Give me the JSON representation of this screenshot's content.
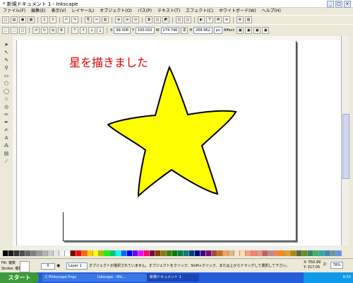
{
  "window": {
    "title": "* 新規ドキュメント 1 - Inkscape",
    "controls": [
      "_",
      "□",
      "×"
    ]
  },
  "menu": [
    "ファイル(F)",
    "編集(E)",
    "表示(V)",
    "レイヤー(L)",
    "オブジェクト(O)",
    "パス(P)",
    "テキスト(T)",
    "エフェクト(C)",
    "ホワイトボード(W)",
    "ヘルプ(H)"
  ],
  "toolbar2": {
    "x_label": "X",
    "x_value": "99.308",
    "y_label": "Y",
    "y_value": "100.002",
    "w_label": "W",
    "w_value": "274.746",
    "h_label": "H",
    "h_value": "268.962",
    "unit": "px",
    "affect_label": "Affect:"
  },
  "canvas": {
    "text": "星を描きました",
    "text_color": "#d90000",
    "star_fill": "#ffff00",
    "star_stroke": "#000000"
  },
  "palette_colors": [
    "#000000",
    "#1a1a1a",
    "#333333",
    "#4d4d4d",
    "#666666",
    "#808080",
    "#999999",
    "#b3b3b3",
    "#cccccc",
    "#e6e6e6",
    "#f2f2f2",
    "#ffffff",
    "#800000",
    "#ff0000",
    "#ff6600",
    "#ffcc00",
    "#ffff00",
    "#99cc00",
    "#00ff00",
    "#00cc66",
    "#00ffff",
    "#0066ff",
    "#0000ff",
    "#6600ff",
    "#ff00ff",
    "#ff0066",
    "#800040",
    "#804000",
    "#808000",
    "#408000",
    "#008000",
    "#008040",
    "#008080",
    "#004080",
    "#000080",
    "#400080",
    "#800080",
    "#a0522d",
    "#d2691e",
    "#f4a460",
    "#deb887",
    "#ffe4c4",
    "#ffdead",
    "#ffa07a",
    "#fa8072",
    "#e9967a",
    "#cd5c5c",
    "#bc8f8f",
    "#ff7f50",
    "#ff8c00",
    "#daa520",
    "#b8860b",
    "#556b2f",
    "#6b8e23",
    "#2e8b57",
    "#3cb371",
    "#20b2aa",
    "#4682b4",
    "#5f9ea0",
    "#6495ed"
  ],
  "status": {
    "fill_label": "Fill:",
    "fill_value": "複数",
    "stroke_label": "Stroke:",
    "stroke_value": "複数",
    "opacity": "0",
    "layer": "Layer 1",
    "message": "オブジェクトが選択されていません。オブジェクトをクリック、Shift+クリック、または上からドラッグして選択して下さい。",
    "x": "X: 550.99",
    "y": "Y: 317.05",
    "zoom_label": "Z:",
    "zoom": "78%"
  },
  "taskbar": {
    "start": "スタート",
    "tasks": [
      "C:¥Inkscape Pngs",
      "Inkscape - Mic...",
      "新規ドキュメント 1"
    ],
    "clock": "8:55"
  }
}
